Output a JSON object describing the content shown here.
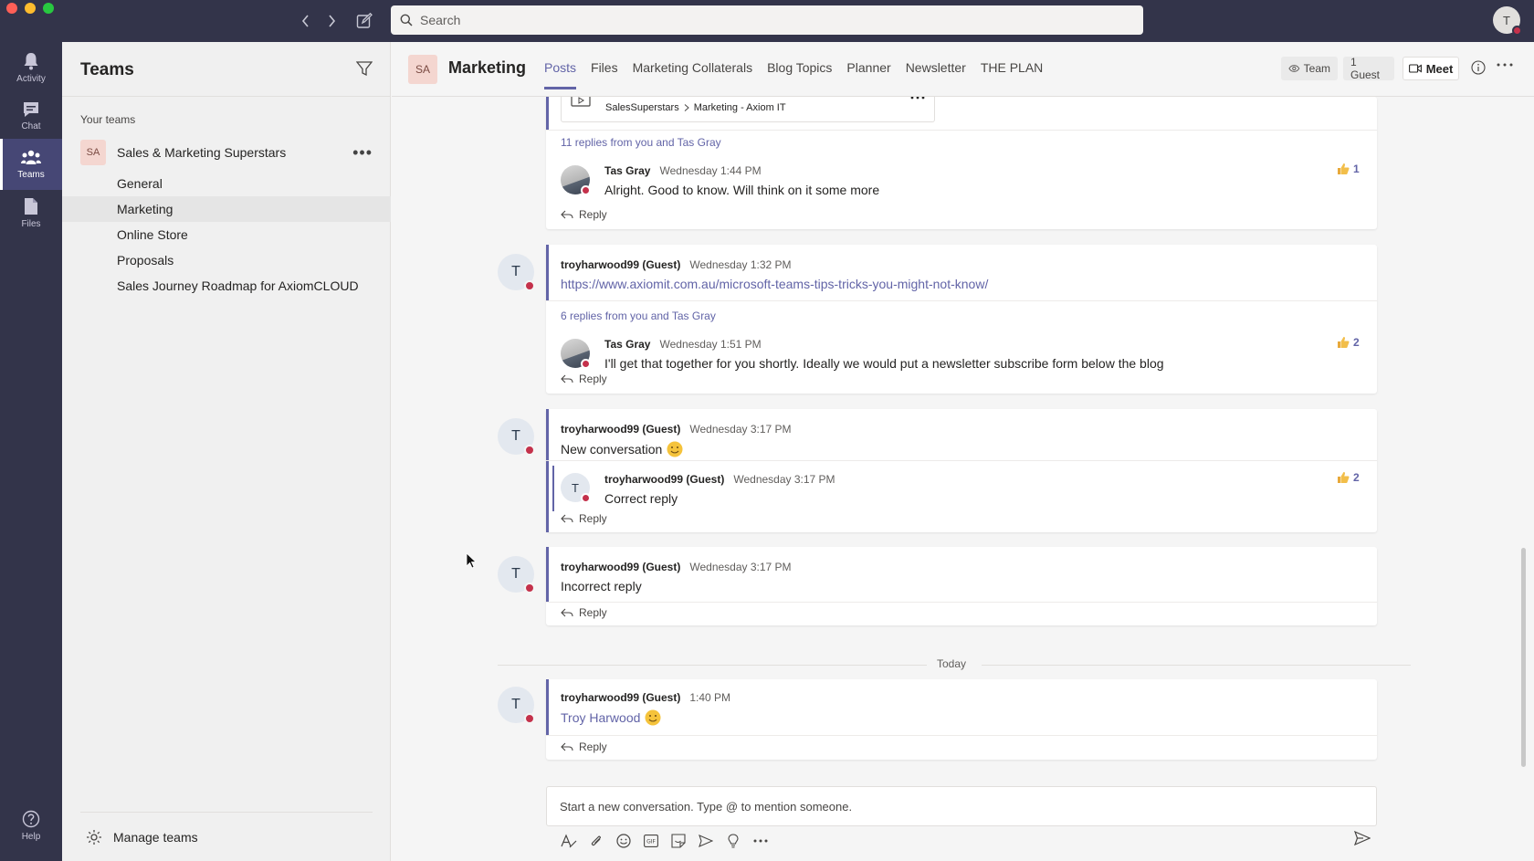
{
  "app": {
    "search_placeholder": "Search",
    "user_initial": "T",
    "accent_color": "#6264a7",
    "rail_color": "#33344a"
  },
  "rail": {
    "items": [
      {
        "label": "Activity",
        "icon": "bell-icon"
      },
      {
        "label": "Chat",
        "icon": "chat-icon"
      },
      {
        "label": "Teams",
        "icon": "teams-icon"
      },
      {
        "label": "Files",
        "icon": "files-icon"
      }
    ],
    "help": "Help"
  },
  "panel": {
    "title": "Teams",
    "your_teams": "Your teams",
    "team": {
      "initials": "SA",
      "name": "Sales & Marketing Superstars",
      "more": "•••"
    },
    "channels": [
      "General",
      "Marketing",
      "Online Store",
      "Proposals",
      "Sales Journey Roadmap for AxiomCLOUD"
    ],
    "active_channel": "Marketing",
    "manage": "Manage teams"
  },
  "channel_header": {
    "initials": "SA",
    "title": "Marketing",
    "tabs": [
      "Posts",
      "Files",
      "Marketing Collaterals",
      "Blog Topics",
      "Planner",
      "Newsletter",
      "THE PLAN"
    ],
    "active_tab": "Posts",
    "team_pill": "Team",
    "guest_pill": "1 Guest",
    "meet": "Meet"
  },
  "feed": {
    "shared_item": {
      "path_a": "SalesSuperstars",
      "path_b": "Marketing - Axiom IT"
    },
    "thread1": {
      "replies_summary": "11 replies from you and Tas Gray",
      "reply": {
        "author": "Tas Gray",
        "time": "Wednesday 1:44 PM",
        "text": "Alright. Good to know. Will think on it some more",
        "likes": "1"
      },
      "reply_label": "Reply"
    },
    "thread2": {
      "initial": "T",
      "author": "troyharwood99 (Guest)",
      "time": "Wednesday 1:32 PM",
      "link": "https://www.axiomit.com.au/microsoft-teams-tips-tricks-you-might-not-know/",
      "replies_summary": "6 replies from you and Tas Gray",
      "reply": {
        "author": "Tas Gray",
        "time": "Wednesday 1:51 PM",
        "text": "I'll get that together for you shortly. Ideally we would put a newsletter subscribe form below the blog",
        "likes": "2"
      },
      "reply_label": "Reply"
    },
    "thread3": {
      "initial": "T",
      "author": "troyharwood99 (Guest)",
      "time": "Wednesday 3:17 PM",
      "text": "New conversation",
      "reply": {
        "initial": "T",
        "author": "troyharwood99 (Guest)",
        "time": "Wednesday 3:17 PM",
        "text": "Correct reply",
        "likes": "2"
      },
      "reply_label": "Reply"
    },
    "thread4": {
      "initial": "T",
      "author": "troyharwood99 (Guest)",
      "time": "Wednesday 3:17 PM",
      "text": "Incorrect reply",
      "reply_label": "Reply"
    },
    "divider": "Today",
    "thread5": {
      "initial": "T",
      "author": "troyharwood99 (Guest)",
      "time": "1:40 PM",
      "mention": "Troy Harwood",
      "reply_label": "Reply"
    }
  },
  "compose": {
    "placeholder": "Start a new conversation. Type @ to mention someone."
  }
}
